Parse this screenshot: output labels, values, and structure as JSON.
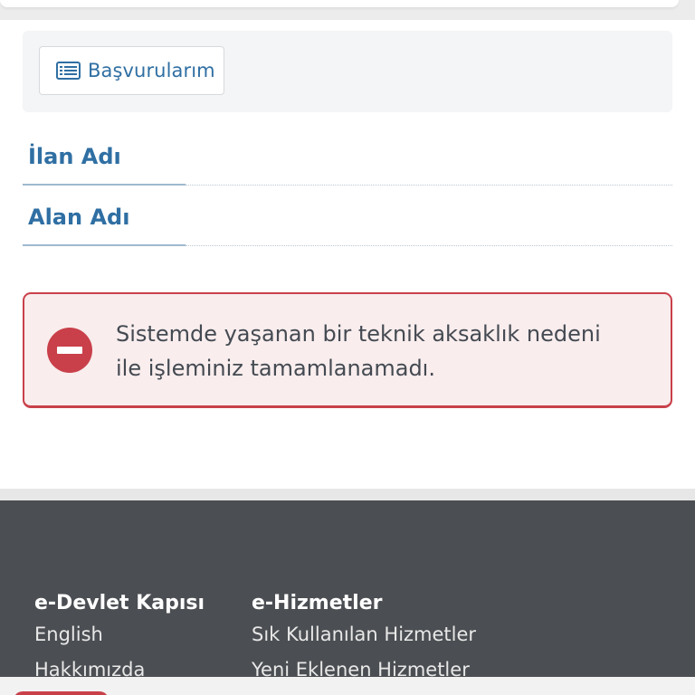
{
  "actions": {
    "applications_button_label": "Başvurularım",
    "applications_icon": "list-icon"
  },
  "fields": [
    {
      "label": "İlan Adı"
    },
    {
      "label": "Alan Adı"
    }
  ],
  "alert": {
    "icon": "error-minus-icon",
    "message": "Sistemde yaşanan bir teknik aksaklık nedeni ile işleminiz tamamlanamadı.",
    "color": "#c9404a"
  },
  "footer": {
    "columns": [
      {
        "title": "e-Devlet Kapısı",
        "links": [
          "English",
          "Hakkımızda"
        ]
      },
      {
        "title": "e-Hizmetler",
        "links": [
          "Sık Kullanılan Hizmetler",
          "Yeni Eklenen Hizmetler"
        ]
      }
    ]
  },
  "colors": {
    "accent": "#2f6fa3",
    "error": "#c9404a",
    "footer_bg": "#4b4e52"
  }
}
